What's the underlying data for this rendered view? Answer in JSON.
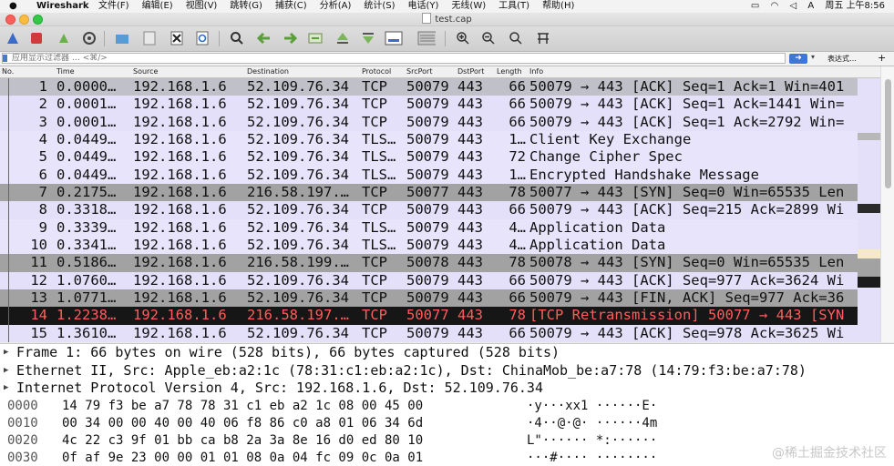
{
  "menubar": {
    "app_name": "Wireshark",
    "menus": [
      "文件(F)",
      "编辑(E)",
      "视图(V)",
      "跳转(G)",
      "捕获(C)",
      "分析(A)",
      "统计(S)",
      "电话(Y)",
      "无线(W)",
      "工具(T)",
      "帮助(H)"
    ],
    "clock": "周五 上午8:56"
  },
  "window": {
    "title": "test.cap"
  },
  "filter": {
    "placeholder": "应用显示过滤器 … <⌘/>",
    "expression_label": "表达式…",
    "add_label": "+"
  },
  "columns": [
    "No.",
    "Time",
    "Source",
    "Destination",
    "Protocol",
    "SrcPort",
    "DstPort",
    "Length",
    "Info"
  ],
  "packets": [
    {
      "no": "1",
      "time": "0.0000…",
      "src": "192.168.1.6",
      "dst": "52.109.76.34",
      "proto": "TCP",
      "sport": "50079",
      "dport": "443",
      "len": "66",
      "info": "50079 → 443 [ACK] Seq=1 Ack=1 Win=401",
      "style": "sel"
    },
    {
      "no": "2",
      "time": "0.0001…",
      "src": "192.168.1.6",
      "dst": "52.109.76.34",
      "proto": "TCP",
      "sport": "50079",
      "dport": "443",
      "len": "66",
      "info": "50079 → 443 [ACK] Seq=1 Ack=1441 Win=",
      "style": "tcp"
    },
    {
      "no": "3",
      "time": "0.0001…",
      "src": "192.168.1.6",
      "dst": "52.109.76.34",
      "proto": "TCP",
      "sport": "50079",
      "dport": "443",
      "len": "66",
      "info": "50079 → 443 [ACK] Seq=1 Ack=2792 Win=",
      "style": "tcp"
    },
    {
      "no": "4",
      "time": "0.0449…",
      "src": "192.168.1.6",
      "dst": "52.109.76.34",
      "proto": "TLS…",
      "sport": "50079",
      "dport": "443",
      "len": "1…",
      "info": "Client Key Exchange",
      "style": "tls"
    },
    {
      "no": "5",
      "time": "0.0449…",
      "src": "192.168.1.6",
      "dst": "52.109.76.34",
      "proto": "TLS…",
      "sport": "50079",
      "dport": "443",
      "len": "72",
      "info": "Change Cipher Spec",
      "style": "tls"
    },
    {
      "no": "6",
      "time": "0.0449…",
      "src": "192.168.1.6",
      "dst": "52.109.76.34",
      "proto": "TLS…",
      "sport": "50079",
      "dport": "443",
      "len": "1…",
      "info": "Encrypted Handshake Message",
      "style": "tls"
    },
    {
      "no": "7",
      "time": "0.2175…",
      "src": "192.168.1.6",
      "dst": "216.58.197.…",
      "proto": "TCP",
      "sport": "50077",
      "dport": "443",
      "len": "78",
      "info": "50077 → 443 [SYN] Seq=0 Win=65535 Len",
      "style": "syn"
    },
    {
      "no": "8",
      "time": "0.3318…",
      "src": "192.168.1.6",
      "dst": "52.109.76.34",
      "proto": "TCP",
      "sport": "50079",
      "dport": "443",
      "len": "66",
      "info": "50079 → 443 [ACK] Seq=215 Ack=2899 Wi",
      "style": "tcp"
    },
    {
      "no": "9",
      "time": "0.3339…",
      "src": "192.168.1.6",
      "dst": "52.109.76.34",
      "proto": "TLS…",
      "sport": "50079",
      "dport": "443",
      "len": "4…",
      "info": "Application Data",
      "style": "tls"
    },
    {
      "no": "10",
      "time": "0.3341…",
      "src": "192.168.1.6",
      "dst": "52.109.76.34",
      "proto": "TLS…",
      "sport": "50079",
      "dport": "443",
      "len": "4…",
      "info": "Application Data",
      "style": "tls"
    },
    {
      "no": "11",
      "time": "0.5186…",
      "src": "192.168.1.6",
      "dst": "216.58.199.…",
      "proto": "TCP",
      "sport": "50078",
      "dport": "443",
      "len": "78",
      "info": "50078 → 443 [SYN] Seq=0 Win=65535 Len",
      "style": "syn"
    },
    {
      "no": "12",
      "time": "1.0760…",
      "src": "192.168.1.6",
      "dst": "52.109.76.34",
      "proto": "TCP",
      "sport": "50079",
      "dport": "443",
      "len": "66",
      "info": "50079 → 443 [ACK] Seq=977 Ack=3624 Wi",
      "style": "tcp"
    },
    {
      "no": "13",
      "time": "1.0771…",
      "src": "192.168.1.6",
      "dst": "52.109.76.34",
      "proto": "TCP",
      "sport": "50079",
      "dport": "443",
      "len": "66",
      "info": "50079 → 443 [FIN, ACK] Seq=977 Ack=36",
      "style": "fin"
    },
    {
      "no": "14",
      "time": "1.2238…",
      "src": "192.168.1.6",
      "dst": "216.58.197.…",
      "proto": "TCP",
      "sport": "50077",
      "dport": "443",
      "len": "78",
      "info": "[TCP Retransmission] 50077 → 443 [SYN",
      "style": "retr"
    },
    {
      "no": "15",
      "time": "1.3610…",
      "src": "192.168.1.6",
      "dst": "52.109.76.34",
      "proto": "TCP",
      "sport": "50079",
      "dport": "443",
      "len": "66",
      "info": "50079 → 443 [ACK] Seq=978 Ack=3625 Wi",
      "style": "tcp"
    }
  ],
  "details": [
    "Frame 1: 66 bytes on wire (528 bits), 66 bytes captured (528 bits)",
    "Ethernet II, Src: Apple_eb:a2:1c (78:31:c1:eb:a2:1c), Dst: ChinaMob_be:a7:78 (14:79:f3:be:a7:78)",
    "Internet Protocol Version 4, Src: 192.168.1.6, Dst: 52.109.76.34"
  ],
  "bytes": [
    {
      "offset": "0000",
      "hex": "14 79 f3 be a7 78 78 31  c1 eb a2 1c 08 00 45 00",
      "ascii": "·y···xx1 ······E·"
    },
    {
      "offset": "0010",
      "hex": "00 34 00 00 40 00 40 06  f8 86 c0 a8 01 06 34 6d",
      "ascii": "·4··@·@· ······4m"
    },
    {
      "offset": "0020",
      "hex": "4c 22 c3 9f 01 bb ca b8  2a 3a 8e 16 d0 ed 80 10",
      "ascii": "L\"······ *:······"
    },
    {
      "offset": "0030",
      "hex": "0f af 9e 23 00 00 01 01  08 0a 04 fc 09 0c 0a 01",
      "ascii": "···#···· ········"
    }
  ],
  "colors": {
    "selected_row": "#c0c0c8",
    "tcp_row": "#e4e0fa",
    "syn_row": "#a2a2a2",
    "retransmission_row_bg": "#161616",
    "retransmission_row_fg": "#ff5d5d"
  },
  "watermark": "@稀土掘金技术社区"
}
